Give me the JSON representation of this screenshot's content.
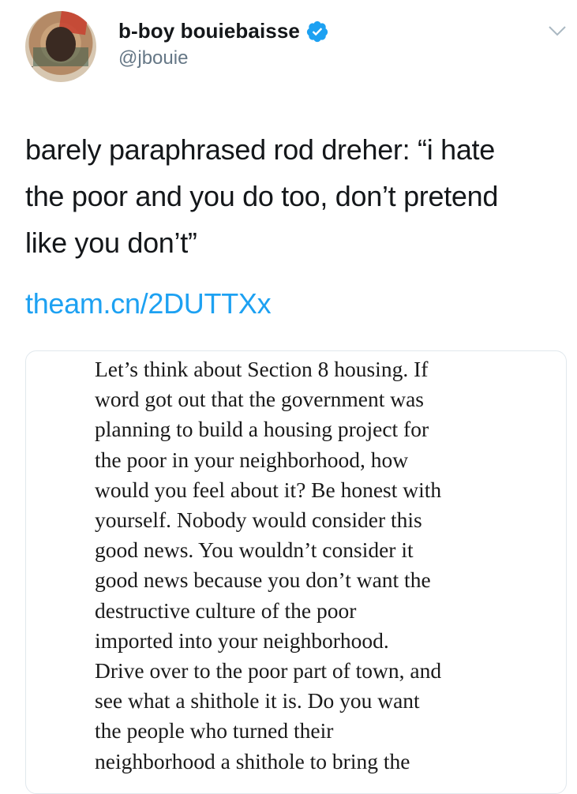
{
  "user": {
    "display_name": "b-boy bouiebaisse",
    "handle": "@jbouie",
    "avatar_tag": "tic"
  },
  "tweet": {
    "text": "barely paraphrased rod dreher: “i hate\nthe poor and you do too, don’t pretend\nlike you don’t”",
    "link": "theam.cn/2DUTTXx"
  },
  "card": {
    "lines": [
      "Let’s think about Section 8 housing. If",
      "word got out that the government was",
      "planning to build a housing project for",
      "the poor in your neighborhood, how",
      "would you feel about it? Be honest with",
      "yourself. Nobody would consider this",
      "good news. You wouldn’t consider it",
      "good news because you don’t want the",
      "destructive culture of the poor",
      "imported into your neighborhood.",
      "Drive over to the poor part of town, and",
      "see what a shithole it is. Do you want",
      "the people who turned their",
      "neighborhood a shithole to bring the"
    ]
  },
  "colors": {
    "accent": "#1da1f2",
    "text": "#14171a",
    "secondary": "#657786"
  },
  "icons": [
    "verified-badge-icon",
    "chevron-down-icon"
  ]
}
